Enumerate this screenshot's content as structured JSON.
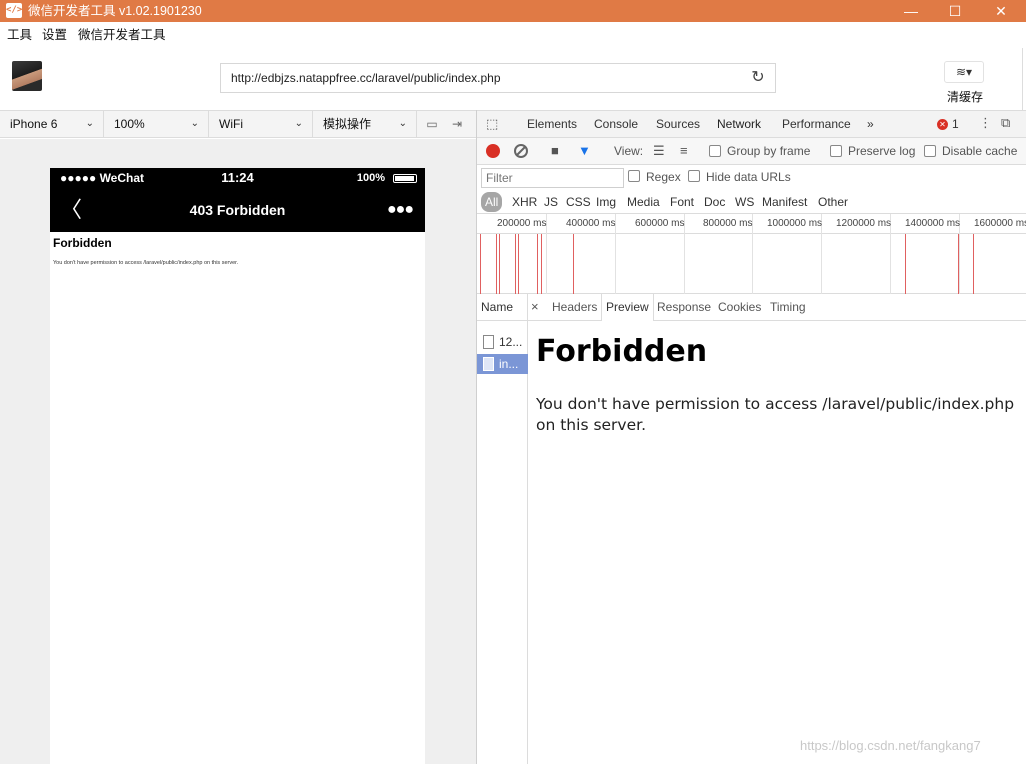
{
  "window": {
    "title": "微信开发者工具 v1.02.1901230",
    "app_icon": "</>",
    "minimize": "—",
    "maximize": "☐",
    "close": "✕"
  },
  "menu": [
    "工具",
    "设置",
    "微信开发者工具"
  ],
  "address": {
    "url": "http://edbjzs.natappfree.cc/laravel/public/index.php",
    "reload_icon": "↻"
  },
  "cache": {
    "icon": "≋▾",
    "label": "清缓存"
  },
  "device_toolbar": {
    "device": "iPhone 6",
    "zoom": "100%",
    "network": "WiFi",
    "simulate": "模拟操作",
    "chevron": "⌄"
  },
  "phone": {
    "carrier": "●●●●● WeChat",
    "time": "11:24",
    "battery": "100%",
    "back": "〈",
    "nav_title": "403 Forbidden",
    "more": "●●●",
    "page_heading": "Forbidden",
    "page_text": "You don't have permission to access /laravel/public/index.php on this server."
  },
  "devtools": {
    "tabs": [
      "Elements",
      "Console",
      "Sources",
      "Network",
      "Performance",
      "»"
    ],
    "active_tab": "Network",
    "error_count": "1",
    "toolbar": {
      "view_label": "View:",
      "group_by_frame": "Group by frame",
      "preserve_log": "Preserve log",
      "disable_cache": "Disable cache"
    },
    "filter": {
      "placeholder": "Filter",
      "regex": "Regex",
      "hide_data_urls": "Hide data URLs"
    },
    "types": [
      "All",
      "XHR",
      "JS",
      "CSS",
      "Img",
      "Media",
      "Font",
      "Doc",
      "WS",
      "Manifest",
      "Other"
    ],
    "timeline_ticks": [
      "200000 ms",
      "400000 ms",
      "600000 ms",
      "800000 ms",
      "1000000 ms",
      "1200000 ms",
      "1400000 ms",
      "1600000 ms"
    ],
    "name_header": "Name",
    "requests": [
      "12...",
      "in..."
    ],
    "preview_tabs": [
      "Headers",
      "Preview",
      "Response",
      "Cookies",
      "Timing"
    ],
    "preview_close": "×",
    "preview": {
      "heading": "Forbidden",
      "text": "You don't have permission to access /laravel/public/index.php on this server."
    }
  },
  "watermark": "https://blog.csdn.net/fangkang7"
}
